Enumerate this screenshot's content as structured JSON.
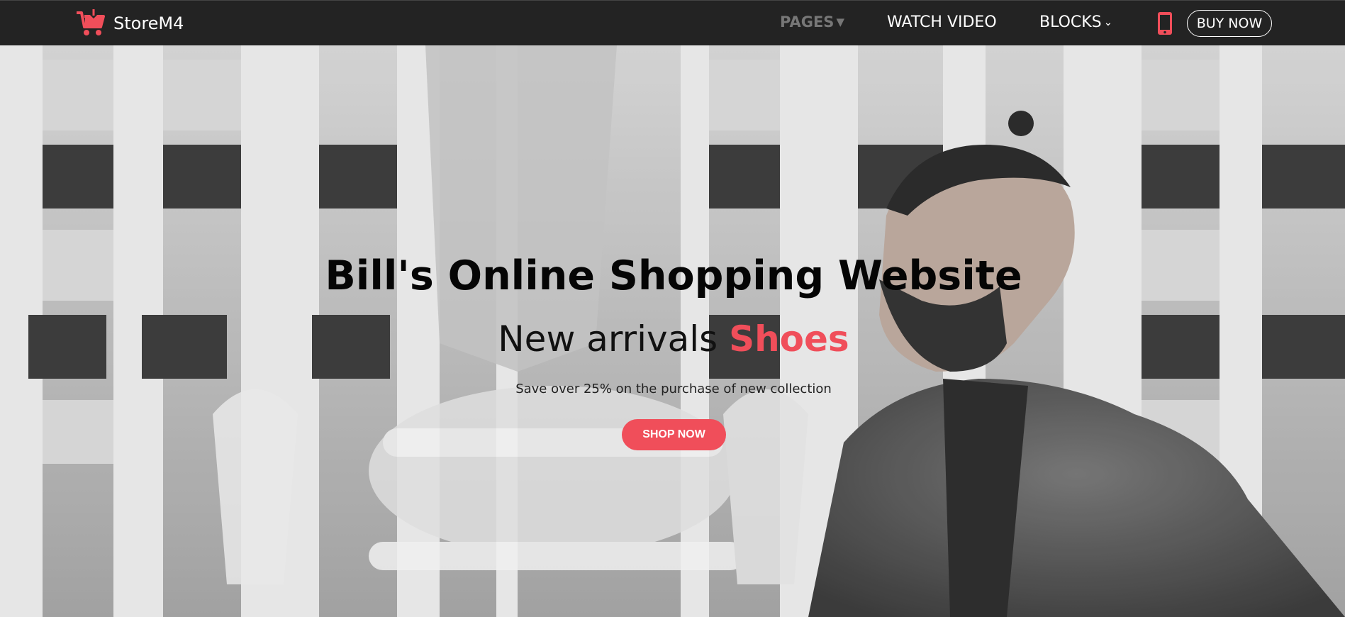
{
  "nav": {
    "brand": "StoreM4",
    "items": [
      {
        "label": "PAGES",
        "caret": "▼"
      },
      {
        "label": "WATCH VIDEO"
      },
      {
        "label": "BLOCKS",
        "caret": "⌄"
      }
    ],
    "buy_label": "BUY NOW"
  },
  "hero": {
    "title": "Bill's Online Shopping Website",
    "subtitle_plain": "New arrivals ",
    "subtitle_accent": "Shoes",
    "description": "Save over 25% on the purchase of new collection",
    "cta": "SHOP NOW"
  },
  "icons": {
    "brand": "shopping-cart-icon",
    "phone": "mobile-phone-icon"
  },
  "colors": {
    "navbar": "#232323",
    "accent": "#f04e5a",
    "nav_muted": "#777777",
    "text_dark": "#050505"
  }
}
